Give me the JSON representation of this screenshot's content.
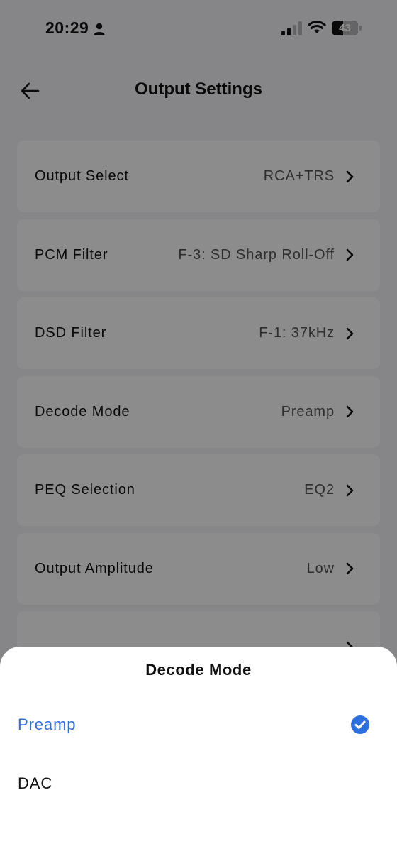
{
  "status_bar": {
    "time": "20:29",
    "battery_level": "43",
    "battery_fraction": 0.43,
    "icons": [
      "person-icon",
      "signal-icon",
      "wifi-icon",
      "battery-icon"
    ]
  },
  "header": {
    "back_icon": "arrow-left-icon",
    "title": "Output Settings"
  },
  "settings": [
    {
      "label": "Output Select",
      "value": "RCA+TRS"
    },
    {
      "label": "PCM Filter",
      "value": "F-3: SD Sharp Roll-Off"
    },
    {
      "label": "DSD Filter",
      "value": "F-1: 37kHz"
    },
    {
      "label": "Decode Mode",
      "value": "Preamp"
    },
    {
      "label": "PEQ Selection",
      "value": "EQ2"
    },
    {
      "label": "Output Amplitude",
      "value": "Low"
    }
  ],
  "sheet": {
    "title": "Decode Mode",
    "options": [
      {
        "label": "Preamp",
        "selected": true
      },
      {
        "label": "DAC",
        "selected": false
      }
    ]
  },
  "colors": {
    "accent": "#2b6fe0",
    "background": "#f5f5f7",
    "overlay": "rgba(0,0,0,0.45)"
  }
}
